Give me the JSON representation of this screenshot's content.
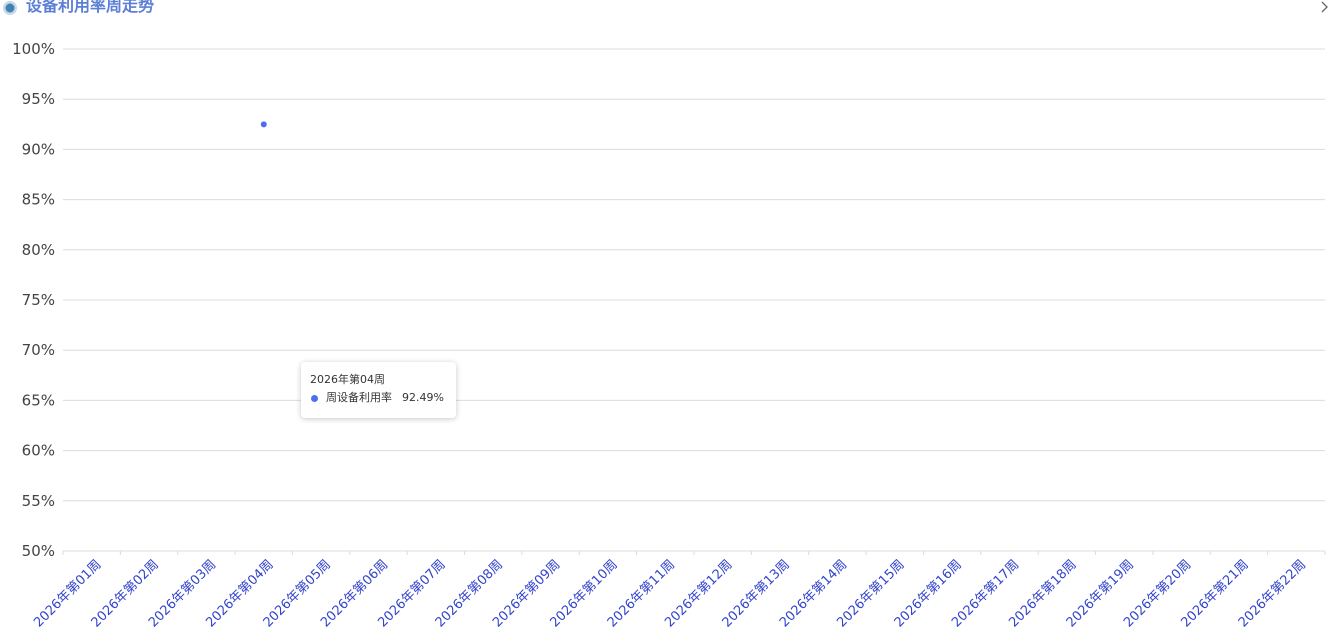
{
  "header": {
    "title": "设备利用率周走势",
    "icon": "circle-dot-icon",
    "expand_icon": "chevron-right-icon"
  },
  "colors": {
    "title": "#5b7fd6",
    "axis_label_x": "#3344cc",
    "axis_label_y": "#444444",
    "grid": "#dcdcdc",
    "series": "#4e6ef2"
  },
  "tooltip": {
    "title": "2026年第04周",
    "series_name": "周设备利用率",
    "value": "92.49%"
  },
  "chart_data": {
    "type": "line",
    "title": "设备利用率周走势",
    "xlabel": "",
    "ylabel": "",
    "ylim": [
      50,
      100
    ],
    "y_ticks": [
      "50%",
      "55%",
      "60%",
      "65%",
      "70%",
      "75%",
      "80%",
      "85%",
      "90%",
      "95%",
      "100%"
    ],
    "categories": [
      "2026年第01周",
      "2026年第02周",
      "2026年第03周",
      "2026年第04周",
      "2026年第05周",
      "2026年第06周",
      "2026年第07周",
      "2026年第08周",
      "2026年第09周",
      "2026年第10周",
      "2026年第11周",
      "2026年第12周",
      "2026年第13周",
      "2026年第14周",
      "2026年第15周",
      "2026年第16周",
      "2026年第17周",
      "2026年第18周",
      "2026年第19周",
      "2026年第20周",
      "2026年第21周",
      "2026年第22周"
    ],
    "series": [
      {
        "name": "周设备利用率",
        "values": [
          null,
          null,
          null,
          92.49,
          null,
          null,
          null,
          null,
          null,
          null,
          null,
          null,
          null,
          null,
          null,
          null,
          null,
          null,
          null,
          null,
          null,
          null
        ]
      }
    ],
    "grid": true,
    "legend": "none"
  }
}
